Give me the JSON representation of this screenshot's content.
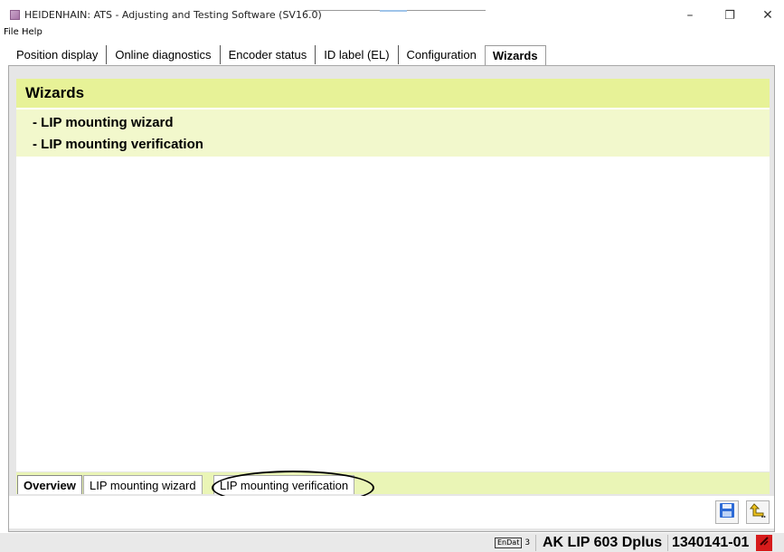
{
  "window": {
    "title": "HEIDENHAIN: ATS - Adjusting and Testing Software (SV16.0)",
    "controls": {
      "minimize": "–",
      "restore": "❐",
      "close": "✕"
    }
  },
  "menu": {
    "items": [
      "File",
      "Help"
    ]
  },
  "main_tabs": [
    {
      "label": "Position display",
      "active": false
    },
    {
      "label": "Online diagnostics",
      "active": false
    },
    {
      "label": "Encoder status",
      "active": false
    },
    {
      "label": "ID label (EL)",
      "active": false
    },
    {
      "label": "Configuration",
      "active": false
    },
    {
      "label": "Wizards",
      "active": true
    }
  ],
  "wizards": {
    "heading": "Wizards",
    "links": [
      "- LIP mounting wizard",
      "- LIP mounting verification"
    ]
  },
  "bottom_tabs": [
    {
      "label": "Overview",
      "active": true
    },
    {
      "label": "LIP mounting wizard",
      "active": false
    },
    {
      "label": "LIP mounting verification",
      "active": false
    }
  ],
  "toolbar": {
    "icons": [
      "save-icon",
      "back-icon"
    ]
  },
  "status": {
    "endat_logo": "EnDat",
    "endat_version": "3",
    "encoder_name": "AK LIP 603 Dplus",
    "id_number": "1340141-01",
    "indicator_color": "#d61b1b"
  },
  "colors": {
    "header_bg": "#e7f297",
    "list_bg": "#f2f8cc",
    "strip_bg": "#eaf5b6"
  }
}
